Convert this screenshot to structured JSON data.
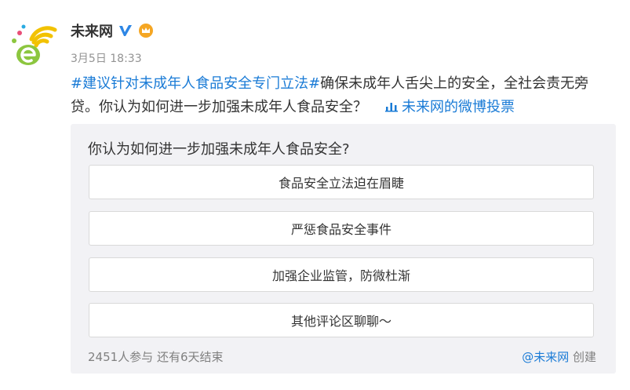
{
  "author": {
    "name": "未来网",
    "timestamp": "3月5日 18:33"
  },
  "content": {
    "hashtag": "#建议针对未成年人食品安全专门立法#",
    "text": "确保未成年人舌尖上的安全，全社会责无旁贷。你认为如何进一步加强未成年人食品安全？",
    "vote_link": "未来网的微博投票"
  },
  "poll": {
    "question": "你认为如何进一步加强未成年人食品安全?",
    "options": [
      {
        "label": "食品安全立法迫在眉睫"
      },
      {
        "label": "严惩食品安全事件"
      },
      {
        "label": "加强企业监管，防微杜渐"
      },
      {
        "label": "其他评论区聊聊～"
      }
    ],
    "stats": "2451人参与  还有6天结束",
    "creator": "@未来网",
    "creator_suffix": " 创建"
  },
  "colors": {
    "link": "#1a7bd6",
    "poll_bg": "#f2f2f5",
    "v_badge": "#2d86e5",
    "member_badge": "#f5a623"
  },
  "icons": {
    "avatar": "weilaiwang-logo",
    "verified": "v-verified-icon",
    "member": "member-crown-icon",
    "vote": "vote-chart-icon"
  }
}
